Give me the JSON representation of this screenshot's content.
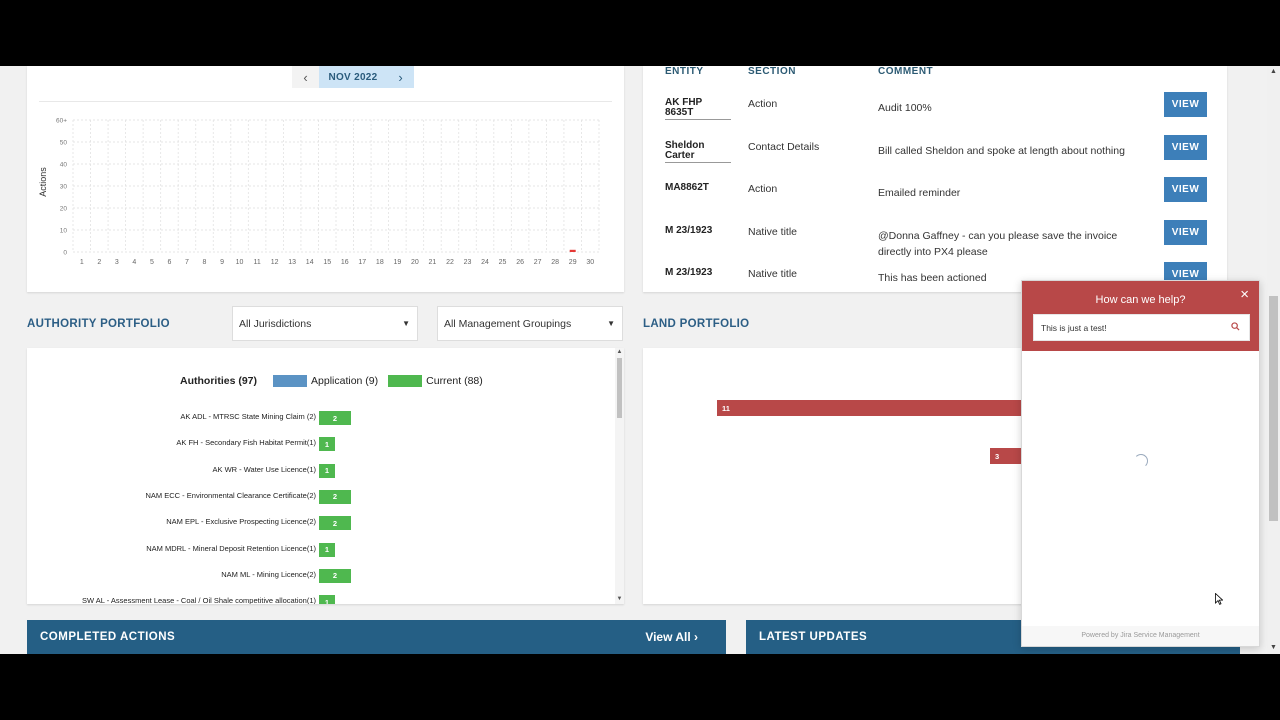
{
  "actions_panel": {
    "month": "NOV 2022",
    "prev_icon": "‹",
    "next_icon": "›"
  },
  "chart_data": {
    "type": "bar",
    "ylabel": "Actions",
    "ylim": [
      0,
      60
    ],
    "y_ticks": [
      "60+",
      "50",
      "40",
      "30",
      "20",
      "10",
      "0"
    ],
    "categories": [
      "1",
      "2",
      "3",
      "4",
      "5",
      "6",
      "7",
      "8",
      "9",
      "10",
      "11",
      "12",
      "13",
      "14",
      "15",
      "16",
      "17",
      "18",
      "19",
      "20",
      "21",
      "22",
      "23",
      "24",
      "25",
      "26",
      "27",
      "28",
      "29",
      "30"
    ],
    "values": [
      0,
      0,
      0,
      0,
      0,
      0,
      0,
      0,
      0,
      0,
      0,
      0,
      0,
      0,
      0,
      0,
      0,
      0,
      0,
      0,
      0,
      0,
      0,
      0,
      0,
      0,
      0,
      0,
      1,
      0
    ],
    "bar_color": "#e53935",
    "grid": true
  },
  "comments_table": {
    "headers": {
      "entity": "ENTITY",
      "section": "SECTION",
      "comment": "COMMENT"
    },
    "view_label": "VIEW",
    "rows": [
      {
        "entity": "AK FHP 8635T",
        "section": "Action",
        "comment": "Audit 100%"
      },
      {
        "entity": "Sheldon Carter",
        "section": "Contact Details",
        "comment": "Bill called Sheldon and spoke at length about nothing"
      },
      {
        "entity": "MA8862T",
        "section": "Action",
        "comment": "Emailed reminder"
      },
      {
        "entity": "M 23/1923",
        "section": "Native title",
        "comment": "@Donna Gaffney - can you please save the invoice directly into PX4 please"
      },
      {
        "entity": "M 23/1923",
        "section": "Native title",
        "comment": "This has been actioned"
      }
    ]
  },
  "authority_portfolio": {
    "heading": "AUTHORITY PORTFOLIO",
    "jurisdiction_select": "All Jurisdictions",
    "grouping_select": "All Management Groupings",
    "chart_title": "Authorities (97)",
    "legend": [
      {
        "label": "Application (9)",
        "color": "#5b93c4"
      },
      {
        "label": "Current (88)",
        "color": "#4fb84f"
      }
    ],
    "rows": [
      {
        "label": "AK ADL - MTRSC State Mining Claim (2)",
        "value": 2
      },
      {
        "label": "AK FH - Secondary Fish Habitat Permit(1)",
        "value": 1
      },
      {
        "label": "AK WR - Water Use Licence(1)",
        "value": 1
      },
      {
        "label": "NAM ECC - Environmental Clearance Certificate(2)",
        "value": 2
      },
      {
        "label": "NAM EPL - Exclusive Prospecting Licence(2)",
        "value": 2
      },
      {
        "label": "NAM MDRL - Mineral Deposit Retention Licence(1)",
        "value": 1
      },
      {
        "label": "NAM ML - Mining Licence(2)",
        "value": 2
      },
      {
        "label": "SW AL - Assessment Lease - Coal / Oil Shale competitive allocation(1)",
        "value": 1
      }
    ]
  },
  "land_portfolio": {
    "heading": "LAND PORTFOLIO",
    "bars": [
      {
        "value": 11
      },
      {
        "value": 3
      }
    ],
    "bar_color": "#b84848"
  },
  "completed_actions": {
    "title": "COMPLETED ACTIONS",
    "link": "View All ›"
  },
  "latest_updates": {
    "title": "LATEST UPDATES"
  },
  "help_widget": {
    "title": "How can we help?",
    "search_value": "This is just a test!",
    "footer": "Powered by Jira Service Management",
    "close_icon": "×"
  }
}
